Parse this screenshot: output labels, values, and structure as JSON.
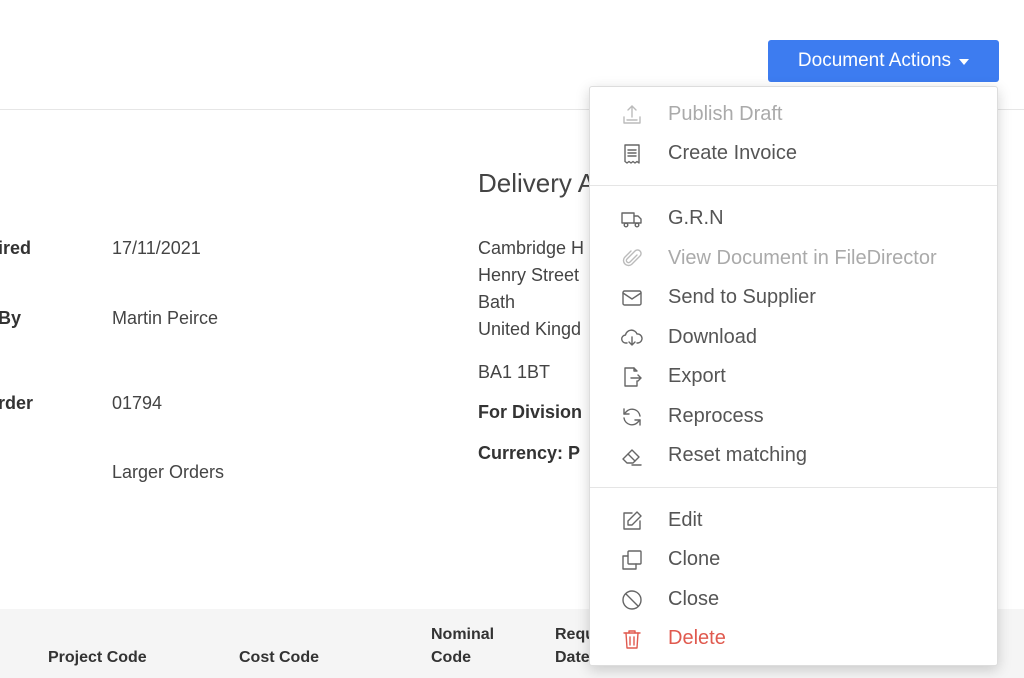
{
  "header": {
    "document_actions_label": "Document Actions"
  },
  "details": {
    "required_label": "ired",
    "required_value": "17/11/2021",
    "by_label": "By",
    "by_value": "Martin Peirce",
    "order_label": "rder",
    "order_value": "01794",
    "category_value": "Larger Orders"
  },
  "delivery": {
    "title": "Delivery A",
    "line1": "Cambridge H",
    "line2": "Henry Street",
    "line3": "Bath",
    "line4": "United Kingd",
    "postcode": "BA1 1BT",
    "for_division": "For Division",
    "currency": "Currency: P"
  },
  "table": {
    "col_project_code": "Project Code",
    "col_cost_code": "Cost Code",
    "col_nominal_line1": "Nominal",
    "col_nominal_line2": "Code",
    "col_req_line1": "Requ",
    "col_req_line2": "Date"
  },
  "menu": {
    "items": [
      {
        "label": "Publish Draft",
        "icon": "upload-icon",
        "disabled": true
      },
      {
        "label": "Create Invoice",
        "icon": "receipt-icon",
        "disabled": false
      },
      {
        "label": "G.R.N",
        "icon": "truck-icon",
        "disabled": false
      },
      {
        "label": "View Document in FileDirector",
        "icon": "paperclip-icon",
        "disabled": true
      },
      {
        "label": "Send to Supplier",
        "icon": "envelope-icon",
        "disabled": false
      },
      {
        "label": "Download",
        "icon": "cloud-download-icon",
        "disabled": false
      },
      {
        "label": "Export",
        "icon": "file-export-icon",
        "disabled": false
      },
      {
        "label": "Reprocess",
        "icon": "refresh-icon",
        "disabled": false
      },
      {
        "label": "Reset matching",
        "icon": "eraser-icon",
        "disabled": false
      },
      {
        "label": "Edit",
        "icon": "edit-icon",
        "disabled": false
      },
      {
        "label": "Clone",
        "icon": "copy-icon",
        "disabled": false
      },
      {
        "label": "Close",
        "icon": "ban-icon",
        "disabled": false
      },
      {
        "label": "Delete",
        "icon": "trash-icon",
        "disabled": false,
        "danger": true
      }
    ]
  },
  "colors": {
    "primary": "#3d7cf0",
    "danger": "#e05a4f"
  }
}
